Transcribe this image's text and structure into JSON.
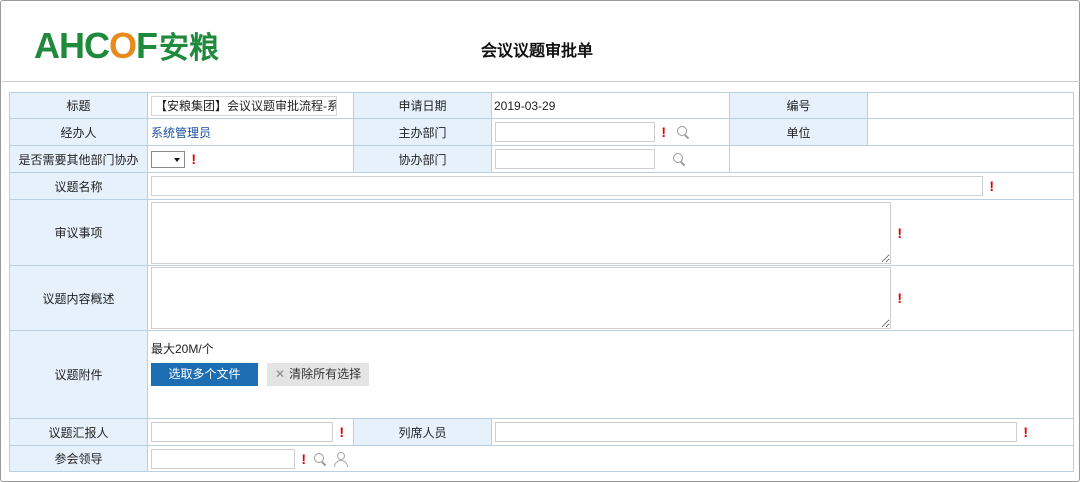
{
  "header": {
    "logo_text_a": "AHC",
    "logo_text_o": "O",
    "logo_text_b": "F",
    "logo_text_cn": "安粮",
    "form_title": "会议议题审批单"
  },
  "form": {
    "title_label": "标题",
    "title_value": "【安粮集团】会议议题审批流程-系统管",
    "apply_date_label": "申请日期",
    "apply_date_value": "2019-03-29",
    "serial_label": "编号",
    "serial_value": "",
    "handler_label": "经办人",
    "handler_value": "系统管理员",
    "main_dept_label": "主办部门",
    "main_dept_value": "",
    "unit_label": "单位",
    "unit_value": "",
    "need_other_dept_label": "是否需要其他部门协办",
    "need_other_dept_value": "",
    "assist_dept_label": "协办部门",
    "assist_dept_value": "",
    "topic_name_label": "议题名称",
    "topic_name_value": "",
    "review_items_label": "审议事项",
    "topic_summary_label": "议题内容概述",
    "attachment_label": "议题附件",
    "attachment_hint": "最大20M/个",
    "select_files_button": "选取多个文件",
    "clear_selection_button": "清除所有选择",
    "reporter_label": "议题汇报人",
    "reporter_value": "",
    "attendees_label": "列席人员",
    "attendees_value": "",
    "leaders_label": "参会领导",
    "leaders_value": "",
    "required_mark": "!"
  },
  "colors": {
    "label_bg": "#e7f1fb",
    "border": "#b9cfe4",
    "primary_button": "#1d6db3",
    "required": "#e00000",
    "logo_green": "#1f8a3c",
    "logo_orange": "#e8891c",
    "link": "#1a4fa0"
  },
  "icons": [
    "search-icon",
    "person-picker-icon",
    "close-icon",
    "dropdown-arrow-icon"
  ]
}
